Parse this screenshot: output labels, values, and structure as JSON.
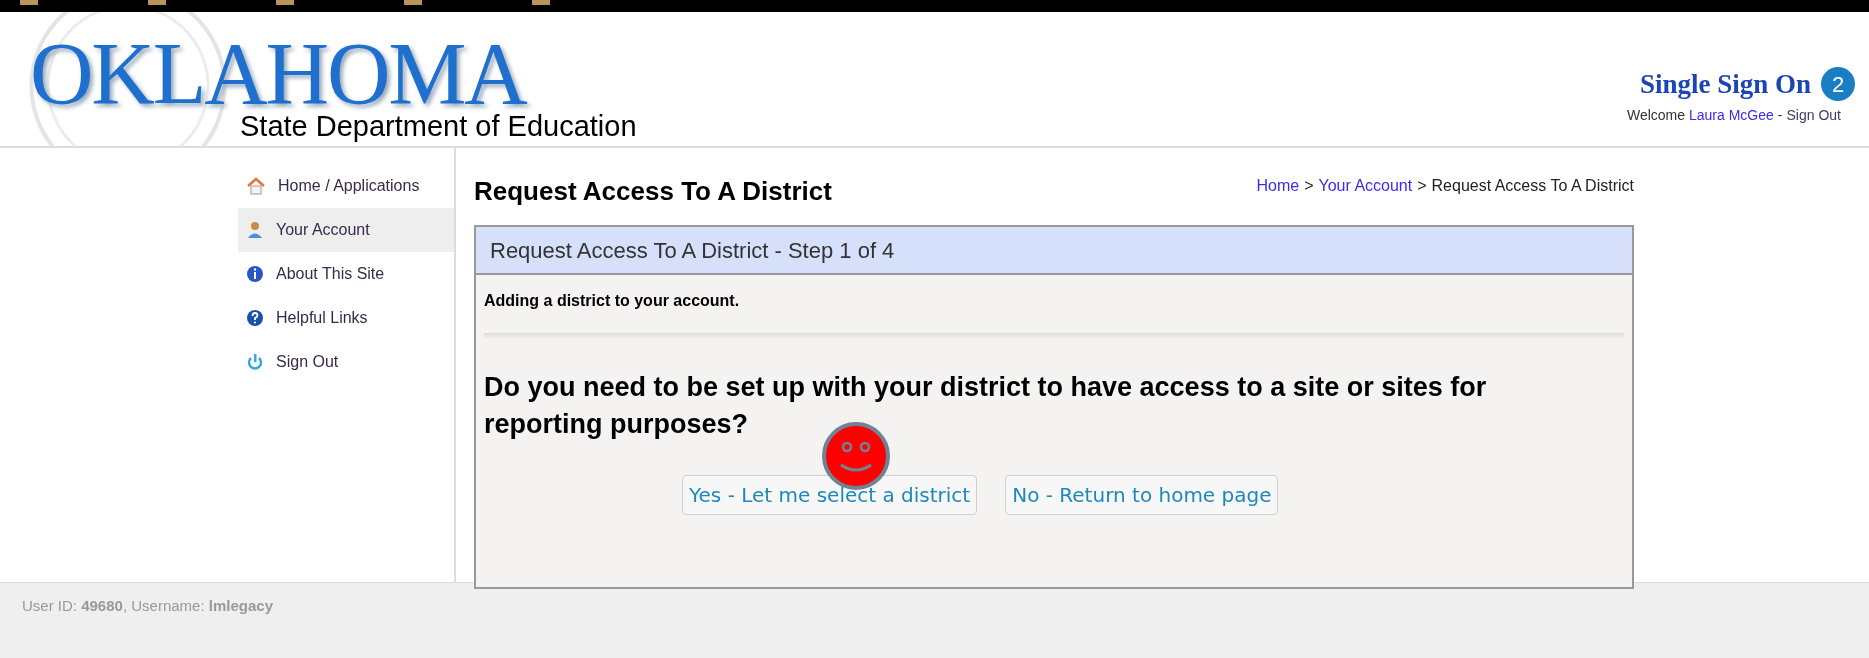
{
  "logo": {
    "title": "OKLAHOMA",
    "subtitle": "State Department of Education"
  },
  "header": {
    "title": "Single Sign On",
    "badge": "2",
    "welcome": "Welcome",
    "user": "Laura McGee",
    "separator": "-",
    "signout": "Sign Out"
  },
  "sidebar": {
    "items": [
      {
        "label": "Home / Applications",
        "kind": "home",
        "selected": false
      },
      {
        "label": "Your Account",
        "kind": "account",
        "selected": true
      },
      {
        "label": "About This Site",
        "kind": "info",
        "selected": false
      },
      {
        "label": "Helpful Links",
        "kind": "help",
        "selected": false
      },
      {
        "label": "Sign Out",
        "kind": "power",
        "selected": false
      }
    ]
  },
  "page": {
    "title": "Request Access To A District",
    "breadcrumb": [
      {
        "label": "Home",
        "link": true
      },
      {
        "label": ">",
        "link": false
      },
      {
        "label": "Your Account",
        "link": true
      },
      {
        "label": ">",
        "link": false
      },
      {
        "label": "Request Access To A District",
        "link": false
      }
    ],
    "panel_title": "Request Access To A District - Step 1 of 4",
    "intro": "Adding a district to your account.",
    "question": "Do you need to be set up with your district to have access to a site or sites for reporting purposes?",
    "buttons": [
      "Yes - Let me select a district",
      "No - Return to home page"
    ]
  },
  "footer": {
    "text": "User ID: **49680**, Username: **lmlegacy**"
  }
}
